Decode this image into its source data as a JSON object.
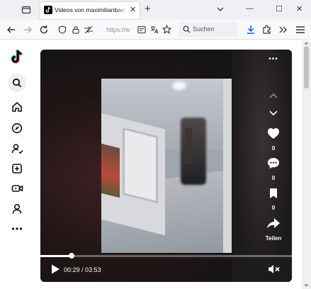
{
  "browser": {
    "tab_title": "Videos von maximilianbaehring",
    "tab_close": "✕",
    "new_tab": "+",
    "window_controls": {
      "minimize": "—",
      "maximize": "☐",
      "close": "✕"
    },
    "url": "https://w",
    "search_placeholder": "Suchen"
  },
  "sidebar": {
    "items": [
      {
        "icon": "tiktok-logo-icon"
      },
      {
        "icon": "search-icon"
      },
      {
        "icon": "home-icon"
      },
      {
        "icon": "explore-compass-icon"
      },
      {
        "icon": "following-icon"
      },
      {
        "icon": "upload-icon"
      },
      {
        "icon": "live-icon"
      },
      {
        "icon": "profile-icon"
      },
      {
        "icon": "more-icon"
      }
    ]
  },
  "video": {
    "more_label": "•••",
    "likes": "0",
    "comments": "0",
    "saves": "0",
    "share_label": "Teilen",
    "time_current": "00:29",
    "time_separator": " / ",
    "time_total": "03:53",
    "progress": 0.125,
    "muted": true
  },
  "colors": {
    "tiktok_cyan": "#25f4ee",
    "tiktok_red": "#fe2c55",
    "video_bg": "#1e1e1e"
  }
}
